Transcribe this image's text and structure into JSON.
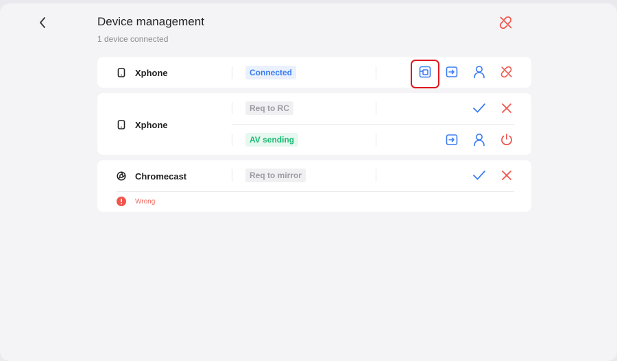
{
  "header": {
    "title": "Device management",
    "subtitle": "1 device connected"
  },
  "devices": [
    {
      "name": "Xphone",
      "icon": "phone-icon",
      "rows": [
        {
          "status": "Connected",
          "status_color": "#3a7cf0"
        }
      ]
    },
    {
      "name": "Xphone",
      "icon": "phone-icon",
      "rows": [
        {
          "status": "Req to RC",
          "status_color": "#9c9ca3"
        },
        {
          "status": "AV sending",
          "status_color": "#19b971"
        }
      ]
    },
    {
      "name": "Chromecast",
      "icon": "chromecast-icon",
      "rows": [
        {
          "status": "Req to mirror",
          "status_color": "#9c9ca3"
        }
      ],
      "error": "Wrong"
    }
  ],
  "colors": {
    "accent": "#3a7cf0",
    "danger": "#f0564d",
    "success": "#19b971",
    "highlight": "#e0161e"
  }
}
